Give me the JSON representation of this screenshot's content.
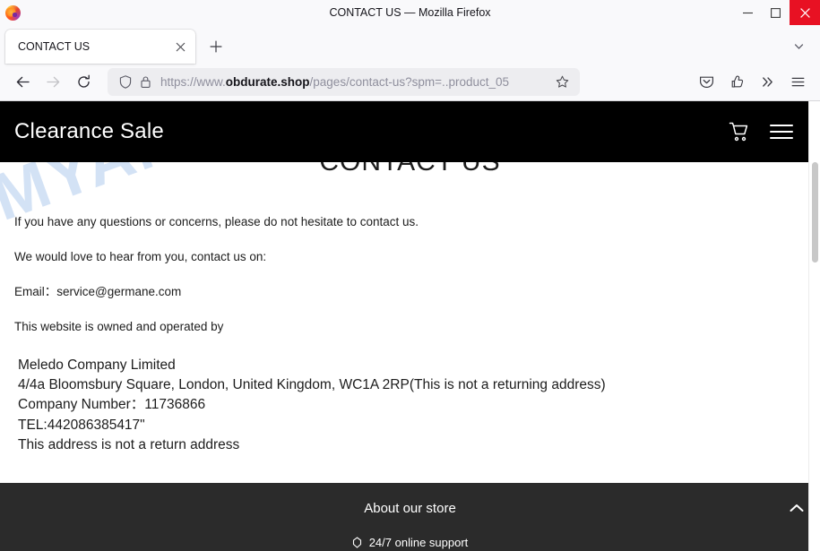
{
  "window": {
    "title": "CONTACT US — Mozilla Firefox",
    "minimize_label": "minimize",
    "maximize_label": "maximize",
    "close_label": "close"
  },
  "tabbar": {
    "tabs": [
      {
        "title": "CONTACT US",
        "close_label": "×"
      }
    ],
    "new_tab_label": "+",
    "list_all_tabs_label": "v"
  },
  "toolbar": {
    "back_label": "Back",
    "forward_label": "Forward",
    "reload_label": "Reload",
    "url_prefix": "https://www.",
    "url_domain": "obdurate.shop",
    "url_path": "/pages/contact-us?spm=..product_05",
    "bookmark_label": "Bookmark this page",
    "pocket_label": "Save to Pocket",
    "account_label": "Account",
    "overflow_label": "More tools",
    "appmenu_label": "Open application menu"
  },
  "site": {
    "brand": "Clearance Sale",
    "cart_label": "Cart",
    "menu_label": "Menu"
  },
  "page": {
    "heading": "CONTACT US",
    "paragraphs": [
      "If you have any questions or concerns, please do not hesitate to contact us.",
      "We would love to hear from you, contact us on:",
      "Email：service@germane.com",
      "This website is owned and operated by"
    ],
    "company": [
      "Meledo Company Limited",
      "4/4a Bloomsbury Square, London, United Kingdom, WC1A 2RP(This is not a returning address)",
      "Company Number：11736866",
      "TEL:442086385417\"",
      "This address is not a return address"
    ],
    "watermark": "MYANTISPYWARE.COM",
    "watermark_color": "#ccddf4"
  },
  "footer": {
    "title": "About our store",
    "collapse_label": "Collapse",
    "sub_item": "24/7 online support"
  },
  "colors": {
    "header_bg": "#000000",
    "footer_bg": "#2b2b2b",
    "chrome_bg": "#f9f9fb",
    "close_red": "#e81123",
    "text": "#1c1c1c"
  }
}
